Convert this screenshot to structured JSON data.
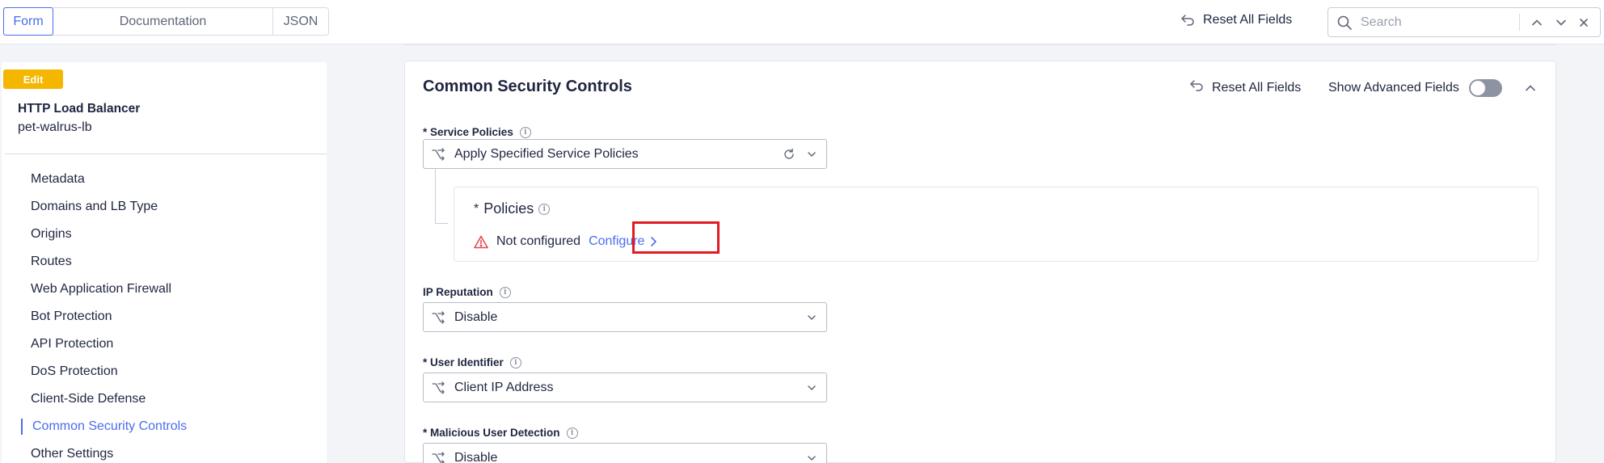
{
  "top_tabs": {
    "form": "Form",
    "documentation": "Documentation",
    "json": "JSON"
  },
  "top_actions": {
    "reset_all": "Reset All Fields",
    "search_placeholder": "Search"
  },
  "sidebar": {
    "badge": "Edit",
    "object_type": "HTTP Load Balancer",
    "object_name": "pet-walrus-lb",
    "items": [
      {
        "label": "Metadata"
      },
      {
        "label": "Domains and LB Type"
      },
      {
        "label": "Origins"
      },
      {
        "label": "Routes"
      },
      {
        "label": "Web Application Firewall"
      },
      {
        "label": "Bot Protection"
      },
      {
        "label": "API Protection"
      },
      {
        "label": "DoS Protection"
      },
      {
        "label": "Client-Side Defense"
      },
      {
        "label": "Common Security Controls"
      },
      {
        "label": "Other Settings"
      }
    ],
    "active_item": "Common Security Controls"
  },
  "section": {
    "title": "Common Security Controls",
    "reset_all": "Reset All Fields",
    "show_advanced": "Show Advanced Fields",
    "show_advanced_enabled": false
  },
  "fields": {
    "service_policies": {
      "label": "* Service Policies",
      "value": "Apply Specified Service Policies"
    },
    "policies": {
      "required_mark": "*",
      "label": "Policies",
      "status": "Not configured",
      "action": "Configure"
    },
    "ip_reputation": {
      "label": "IP Reputation",
      "value": "Disable"
    },
    "user_identifier": {
      "label": "* User Identifier",
      "value": "Client IP Address"
    },
    "malicious_user_detection": {
      "label": "* Malicious User Detection",
      "value": "Disable"
    }
  },
  "colors": {
    "accent": "#4a6cf0",
    "badge": "#f5b600",
    "warning": "#e5484d",
    "highlight": "#e01b24"
  }
}
